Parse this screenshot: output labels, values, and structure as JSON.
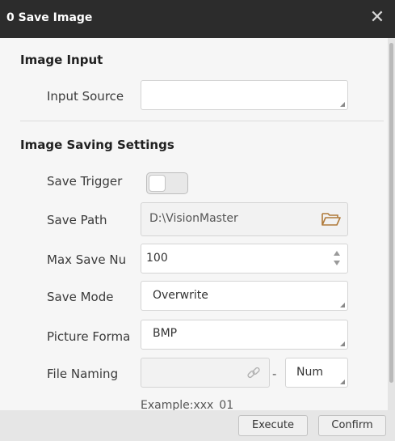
{
  "window": {
    "title": "0 Save Image",
    "close_glyph": "✕"
  },
  "sections": {
    "image_input": "Image Input",
    "image_saving": "Image Saving Settings"
  },
  "fields": {
    "input_source": {
      "label": "Input Source",
      "value": ""
    },
    "save_trigger": {
      "label": "Save Trigger",
      "on": false
    },
    "save_path": {
      "label": "Save Path",
      "value": "D:\\VisionMaster",
      "icon": "folder-icon"
    },
    "max_save_num": {
      "label": "Max Save Nu",
      "value": "100"
    },
    "save_mode": {
      "label": "Save Mode",
      "value": "Overwrite"
    },
    "picture_format": {
      "label": "Picture Forma",
      "value": "BMP"
    },
    "file_naming": {
      "label": "File Naming",
      "value": "",
      "separator": "-",
      "suffix": "Num",
      "icon": "link-icon"
    }
  },
  "example": "Example:xxx_01",
  "footer": {
    "execute": "Execute",
    "confirm": "Confirm"
  },
  "colors": {
    "titlebar": "#2c2c2c",
    "background": "#f6f6f6",
    "icon": "#b07a3a"
  }
}
